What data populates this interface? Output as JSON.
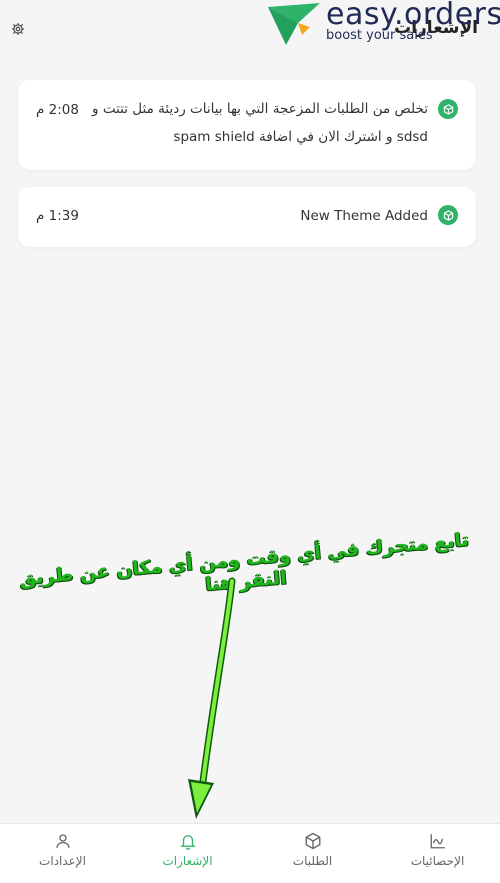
{
  "header": {
    "page_title": "الإشعارات",
    "settings_icon": "gear-icon",
    "logo": {
      "word": "easy.orders",
      "tagline": "boost your sales",
      "colors": {
        "green": "#2fb36a",
        "orange": "#f5a623",
        "navy": "#1f2a55"
      }
    }
  },
  "notifications": [
    {
      "icon": "box-icon",
      "text": "تخلص من الطلبات المزعجة التي بها بيانات رديئة مثل تتتت و sdsd و اشترك الان في اضافة spam shield",
      "time": "2:08 م"
    },
    {
      "icon": "box-icon",
      "text": "New Theme Added",
      "time": "1:39 م"
    }
  ],
  "overlay": {
    "hint_text": "تابع متجرك في أي وقت ومن أي مكان عن طريق النقر هنا",
    "color": "#23b51f"
  },
  "bottom_nav": {
    "items": [
      {
        "label": "الإعدادات",
        "icon": "person-icon",
        "active": false
      },
      {
        "label": "الإشعارات",
        "icon": "bell-icon",
        "active": true
      },
      {
        "label": "الطلبات",
        "icon": "box-icon",
        "active": false
      },
      {
        "label": "الإحصائيات",
        "icon": "chart-icon",
        "active": false
      }
    ],
    "active_color": "#2fb36a"
  }
}
